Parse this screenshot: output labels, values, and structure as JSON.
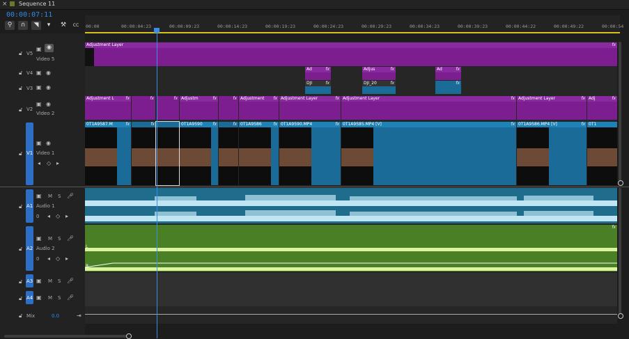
{
  "tab": {
    "close": "×",
    "title": "Sequence 11"
  },
  "timecode": "00:00:07:11",
  "tools": [
    "⚲",
    "∩",
    "◥",
    "▾",
    "⚒",
    "CC"
  ],
  "ruler_labels": [
    "00:00",
    "00:00:04:23",
    "00:00:09:23",
    "00:00:14:23",
    "00:00:19:23",
    "00:00:24:23",
    "00:00:29:23",
    "00:00:34:23",
    "00:00:39:23",
    "00:00:44:22",
    "00:00:49:22",
    "00:00:54"
  ],
  "tracks": {
    "v5": {
      "id": "V5",
      "name": "Video 5"
    },
    "v4": {
      "id": "V4"
    },
    "v3": {
      "id": "V3"
    },
    "v2": {
      "id": "V2",
      "name": "Video 2"
    },
    "v1": {
      "id": "V1",
      "target": "V1",
      "name": "Video 1"
    },
    "a1": {
      "id": "A1",
      "target": "A1",
      "name": "Audio 1",
      "m": "M",
      "s": "S",
      "vol": "0"
    },
    "a2": {
      "id": "A2",
      "target": "A2",
      "name": "Audio 2",
      "m": "M",
      "s": "S",
      "vol": "0"
    },
    "a3": {
      "id": "A3",
      "target": "A3",
      "m": "M",
      "s": "S"
    },
    "a4": {
      "id": "A4",
      "target": "A4",
      "m": "M",
      "s": "S"
    },
    "mix": {
      "label": "Mix",
      "value": "0.0"
    }
  },
  "clips": {
    "v5_adj": "Adjustment Layer",
    "v4_a": "Ad",
    "v4_b": "Adjus",
    "v4_c": "Ad",
    "v3_a": "DJI",
    "v3_b": "DJI_20",
    "v2_a": "Adjustment L",
    "v2_b": "Adjustm",
    "v2_c": "Adjustment",
    "v2_d": "Adjustment Layer",
    "v2_e": "Adjustment Layer",
    "v2_f": "Adjustment Layer",
    "v2_g": "Adj",
    "v1_a": "0T1A9587.M",
    "v1_b": "0T1A9590",
    "v1_c": "0T1A9586",
    "v1_d": "0T1A9590.MP4",
    "v1_e": "0T1A9585.MP4 [V]",
    "v1_f": "0T1A9586.MP4 [V]",
    "v1_g": "0T1",
    "fx": "fx",
    "audio_l": "L",
    "audio_r": "R"
  },
  "colors": {
    "adjustment": "#7c1e8f",
    "video": "#1a6b97",
    "audio1": "#1f6c8c",
    "audio2": "#4a7f26",
    "playhead": "#3a8ce8",
    "timecode": "#2e8de6"
  }
}
